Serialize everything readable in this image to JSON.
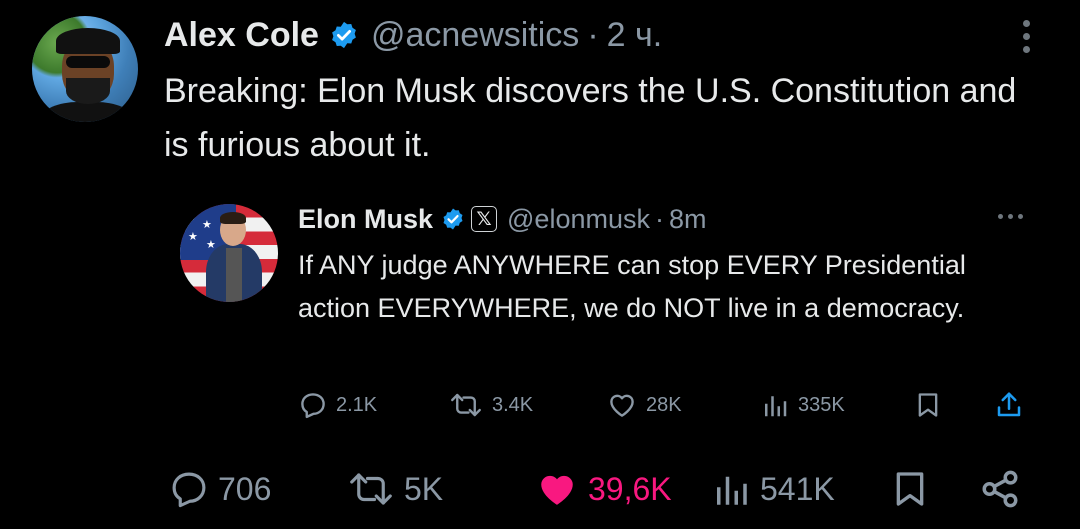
{
  "outer_tweet": {
    "author_name": "Alex Cole",
    "handle": "@acnewsitics",
    "separator": "·",
    "time": "2 ч.",
    "text": "Breaking: Elon Musk discovers the U.S. Constitution and is furious about it.",
    "actions": {
      "replies": "706",
      "reposts": "5K",
      "likes": "39,6K",
      "views": "541K"
    },
    "liked": true
  },
  "quoted_tweet": {
    "author_name": "Elon Musk",
    "affiliate_badge": "𝕏",
    "handle": "@elonmusk",
    "separator": "·",
    "time": "8m",
    "text": "If ANY judge ANYWHERE can stop EVERY Presidential action EVERYWHERE, we do NOT live in a democracy.",
    "actions": {
      "replies": "2.1K",
      "reposts": "3.4K",
      "likes": "28K",
      "views": "335K"
    }
  },
  "colors": {
    "background": "#000000",
    "primary_text": "#e7e9ea",
    "secondary_text": "#8b98a5",
    "verified_blue": "#1d9bf0",
    "like_pink": "#f91880"
  },
  "icons": [
    "verified-badge-icon",
    "more-icon",
    "reply-icon",
    "repost-icon",
    "like-icon",
    "views-icon",
    "bookmark-icon",
    "share-icon"
  ]
}
